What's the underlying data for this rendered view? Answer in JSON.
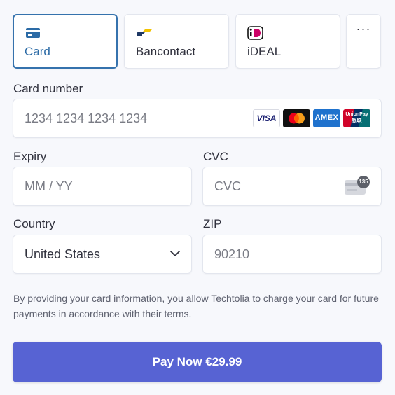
{
  "tabs": [
    {
      "label": "Card",
      "icon": "credit-card-icon",
      "selected": true
    },
    {
      "label": "Bancontact",
      "icon": "bancontact-logo-icon",
      "selected": false
    },
    {
      "label": "iDEAL",
      "icon": "ideal-logo-icon",
      "selected": false
    },
    {
      "label": "···",
      "icon": "more-icon",
      "selected": false
    }
  ],
  "card_number": {
    "label": "Card number",
    "placeholder": "1234 1234 1234 1234",
    "brands": [
      "VISA",
      "mastercard",
      "AMEX",
      "UnionPay 银联"
    ]
  },
  "expiry": {
    "label": "Expiry",
    "placeholder": "MM / YY"
  },
  "cvc": {
    "label": "CVC",
    "placeholder": "CVC",
    "badge": "135"
  },
  "country": {
    "label": "Country",
    "value": "United States"
  },
  "zip": {
    "label": "ZIP",
    "placeholder": "90210"
  },
  "notice": "By providing your card information, you allow Techtolia to charge your card for future payments in accordance with their terms.",
  "pay_button": {
    "label": "Pay Now €29.99"
  },
  "colors": {
    "accent": "#5763d3",
    "selected_tab_border": "#3572ad",
    "background": "#f7f8fc"
  }
}
